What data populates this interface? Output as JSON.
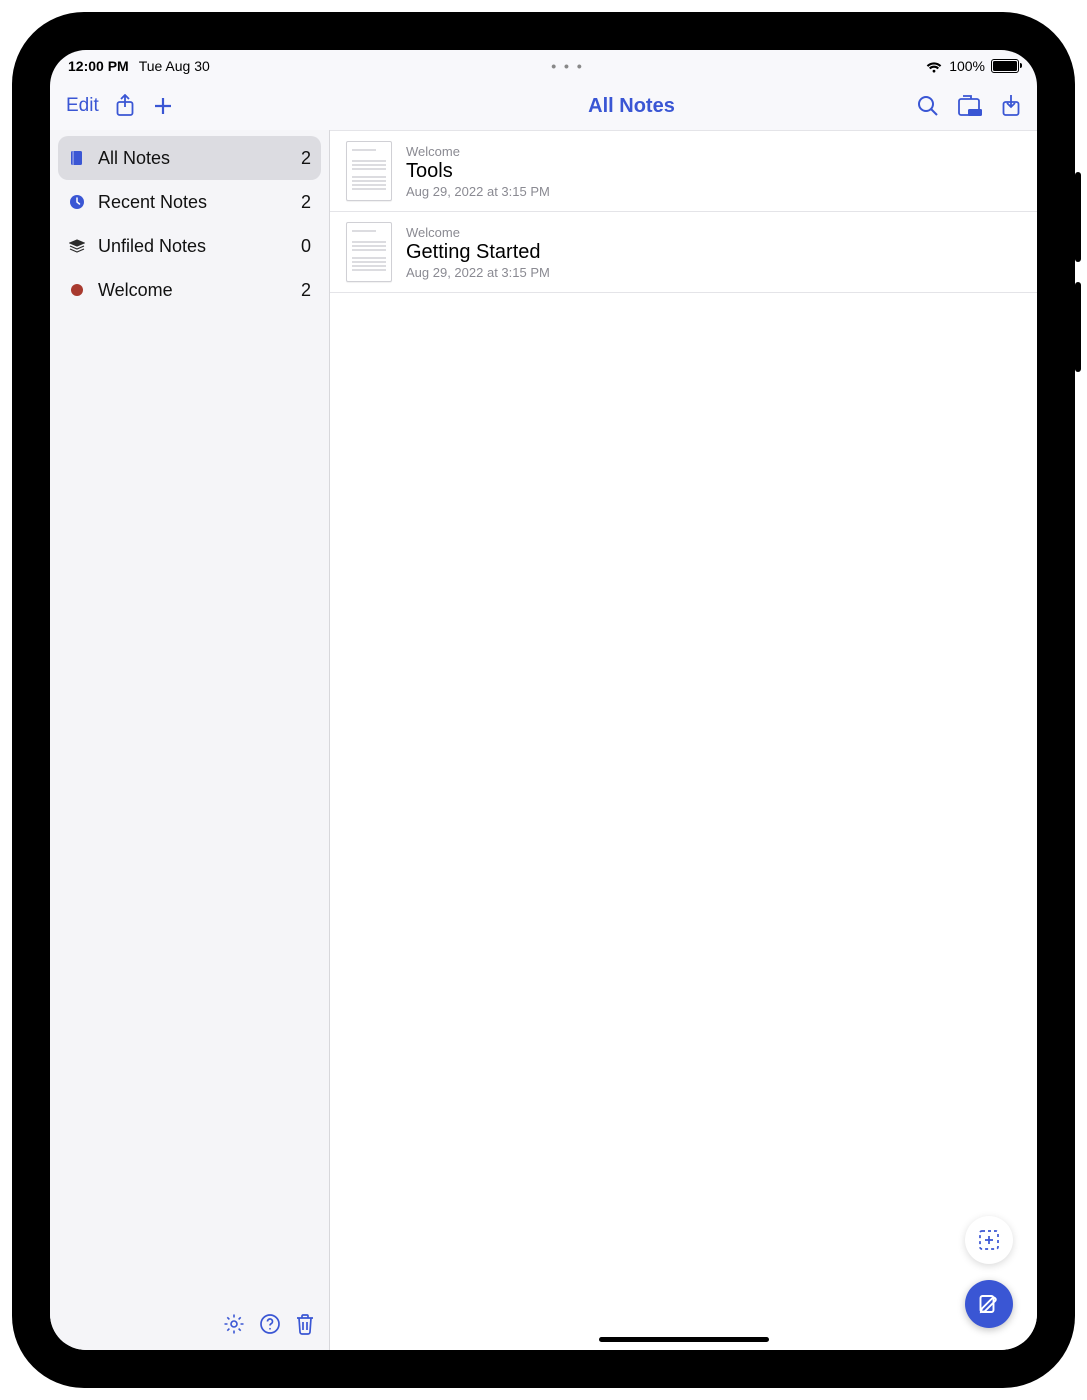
{
  "status": {
    "time": "12:00 PM",
    "date": "Tue Aug 30",
    "battery_pct": "100%",
    "ellipsis": "• • •"
  },
  "toolbar": {
    "edit_label": "Edit",
    "title": "All Notes"
  },
  "sidebar": {
    "items": [
      {
        "name": "sidebar-item-all-notes",
        "label": "All Notes",
        "count": "2",
        "selected": true,
        "icon": "notebook-icon",
        "icon_color": "#3a56d4"
      },
      {
        "name": "sidebar-item-recent-notes",
        "label": "Recent Notes",
        "count": "2",
        "selected": false,
        "icon": "clock-icon",
        "icon_color": "#3a56d4"
      },
      {
        "name": "sidebar-item-unfiled-notes",
        "label": "Unfiled Notes",
        "count": "0",
        "selected": false,
        "icon": "stack-icon",
        "icon_color": "#2b2b2b"
      },
      {
        "name": "sidebar-item-welcome",
        "label": "Welcome",
        "count": "2",
        "selected": false,
        "icon": "dot-icon",
        "icon_color": "#a83a2f"
      }
    ]
  },
  "notes": [
    {
      "folder": "Welcome",
      "title": "Tools",
      "timestamp": "Aug 29, 2022 at 3:15 PM"
    },
    {
      "folder": "Welcome",
      "title": "Getting Started",
      "timestamp": "Aug 29, 2022 at 3:15 PM"
    }
  ]
}
